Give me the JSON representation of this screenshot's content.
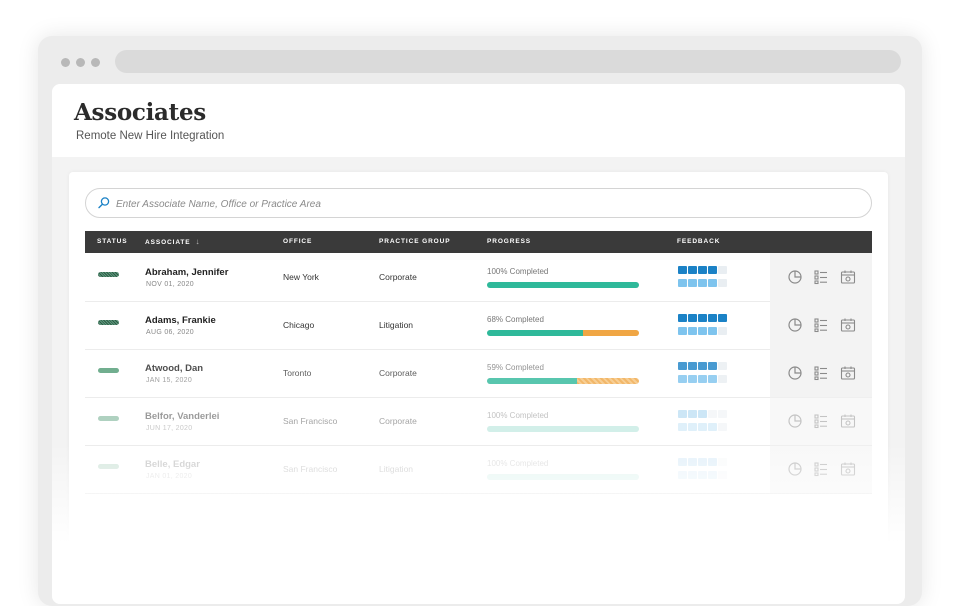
{
  "page": {
    "title": "Associates",
    "subtitle": "Remote New Hire Integration"
  },
  "search": {
    "placeholder": "Enter Associate Name, Office or Practice Area"
  },
  "table": {
    "columns": {
      "status": "STATUS",
      "associate": "ASSOCIATE",
      "office": "OFFICE",
      "practice_group": "PRACTICE GROUP",
      "progress": "PROGRESS",
      "feedback": "FEEDBACK"
    },
    "rows": [
      {
        "name": "Abraham, Jennifer",
        "date": "NOV 01, 2020",
        "office": "New York",
        "practice_group": "Corporate",
        "progress_label": "100% Completed",
        "progress_green": 1.0,
        "progress_orange": 0.0,
        "opacity": 1.0,
        "status_color": "#2f6b4e",
        "feedback_top": [
          4,
          0
        ],
        "feedback_bottom": [
          4,
          0
        ]
      },
      {
        "name": "Adams, Frankie",
        "date": "AUG 06, 2020",
        "office": "Chicago",
        "practice_group": "Litigation",
        "progress_label": "68% Completed",
        "progress_green": 0.63,
        "progress_orange": 0.37,
        "opacity": 1.0,
        "status_color": "#2f6b4e",
        "feedback_top": [
          5,
          0
        ],
        "feedback_bottom": [
          4,
          0
        ]
      },
      {
        "name": "Atwood, Dan",
        "date": "JAN 15, 2020",
        "office": "Toronto",
        "practice_group": "Corporate",
        "progress_label": "59% Completed",
        "progress_green": 0.59,
        "progress_orange": 0.41,
        "opacity": 0.8,
        "status_color": "#4e9a73",
        "feedback_top": [
          4,
          0
        ],
        "feedback_bottom": [
          4,
          0
        ]
      },
      {
        "name": "Belfor, Vanderlei",
        "date": "JUN 17, 2020",
        "office": "San Francisco",
        "practice_group": "Corporate",
        "progress_label": "100% Completed",
        "progress_green": 1.0,
        "progress_orange": 0.0,
        "opacity": 0.45,
        "status_color": "#4e9a73",
        "feedback_top": [
          3,
          0
        ],
        "feedback_bottom": [
          4,
          0
        ]
      },
      {
        "name": "Belle, Edgar",
        "date": "JAN 01, 2020",
        "office": "San Francisco",
        "practice_group": "Litigation",
        "progress_label": "100% Completed",
        "progress_green": 1.0,
        "progress_orange": 0.0,
        "opacity": 0.22,
        "status_color": "#4e9a73",
        "feedback_top": [
          4,
          0
        ],
        "feedback_bottom": [
          4,
          0
        ]
      }
    ]
  },
  "icons": {
    "search": "search-icon",
    "actions": [
      "pie-chart-icon",
      "checklist-icon",
      "calendar-icon"
    ]
  },
  "colors": {
    "header_bar": "#3a3a3a",
    "progress_green": "#2fb99a",
    "progress_orange": "#f0a644",
    "feedback_dark": "#1b82c6",
    "feedback_light": "#7ec4ee",
    "feedback_empty": "#e9eef2"
  }
}
